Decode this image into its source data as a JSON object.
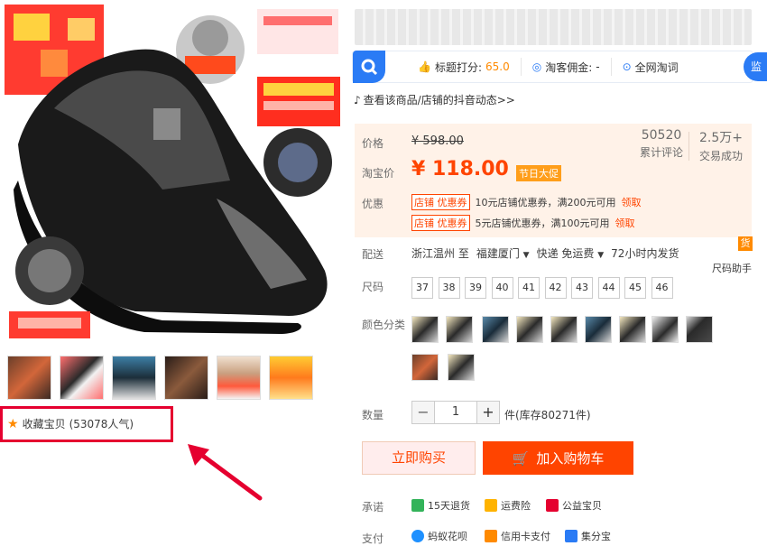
{
  "page": {
    "title_blurred": ""
  },
  "gallery": {
    "thumb_count": 6,
    "favorite_label": "收藏宝贝",
    "favorite_count": "(53078人气)"
  },
  "toolbar": {
    "rating_label": "标题打分:",
    "rating_value": "65.0",
    "commission_label": "淘客佣金:",
    "commission_value": "-",
    "search_label": "全网淘词",
    "side_label": "监"
  },
  "douyin": {
    "text": "查看该商品/店铺的抖音动态>>"
  },
  "price": {
    "label_price": "价格",
    "old_price": "¥ 598.00",
    "label_taobao": "淘宝价",
    "new_price": "¥ 118.00",
    "badge": "节日大促",
    "reviews_num": "50520",
    "reviews_label": "累计评论",
    "deals_num": "2.5万+",
    "deals_label": "交易成功"
  },
  "coupons": {
    "label": "优惠",
    "items": [
      {
        "tag": "店铺 优惠券",
        "text": "10元店铺优惠券，满200元可用",
        "action": "领取"
      },
      {
        "tag": "店铺 优惠券",
        "text": "5元店铺优惠券，满100元可用",
        "action": "领取"
      }
    ]
  },
  "shipping": {
    "label": "配送",
    "from": "浙江温州 至",
    "to": "福建厦门",
    "express": "快递 免运费",
    "ship_time": "72小时内发货",
    "helper_badge": "货",
    "helper_label": "尺码助手"
  },
  "size": {
    "label": "尺码",
    "options": [
      "37",
      "38",
      "39",
      "40",
      "41",
      "42",
      "43",
      "44",
      "45",
      "46"
    ]
  },
  "color": {
    "label": "颜色分类"
  },
  "quantity": {
    "label": "数量",
    "minus": "−",
    "value": "1",
    "plus": "+",
    "stock": "件(库存80271件)"
  },
  "buttons": {
    "buy": "立即购买",
    "cart": "加入购物车"
  },
  "promise": {
    "label": "承诺",
    "items": [
      "15天退货",
      "运费险",
      "公益宝贝"
    ]
  },
  "payment": {
    "label": "支付",
    "items": [
      "蚂蚁花呗",
      "信用卡支付",
      "集分宝"
    ]
  },
  "colors": {
    "accent": "#ff4400",
    "highlight_box": "#e5002f",
    "toolbar_blue": "#2a7bf5"
  }
}
